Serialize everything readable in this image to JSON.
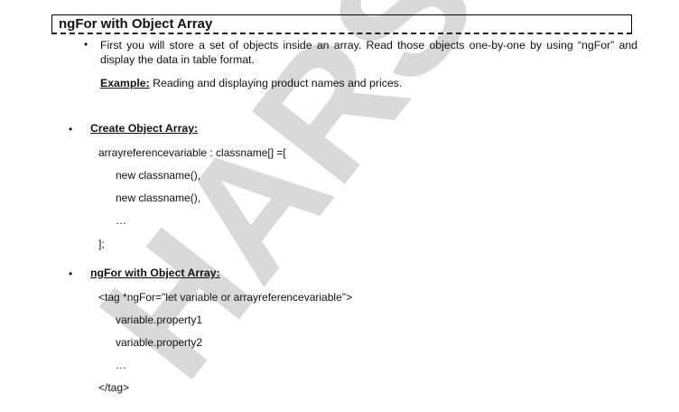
{
  "title": "ngFor with Object Array",
  "intro": {
    "line1": "First you will store a set of objects inside an array. Read those objects one-by-one by using “ngFor” and",
    "line2": "display the data in table format.",
    "example_label": "Example:",
    "example_text": " Reading and displaying product names and prices."
  },
  "section1": {
    "heading": "Create Object Array:",
    "lines": [
      "arrayreferencevariable : classname[] =[",
      "new classname(),",
      "new classname(),",
      "…",
      "];"
    ]
  },
  "section2": {
    "heading": "ngFor with Object Array:",
    "lines": [
      "<tag *ngFor=\"let variable or arrayreferencevariable\">",
      "variable.property1",
      "variable.property2",
      "…",
      "</tag>"
    ]
  },
  "watermark": {
    "text": "HARSHA",
    "color": "#d9d9d9"
  },
  "bullet_glyph": "•"
}
